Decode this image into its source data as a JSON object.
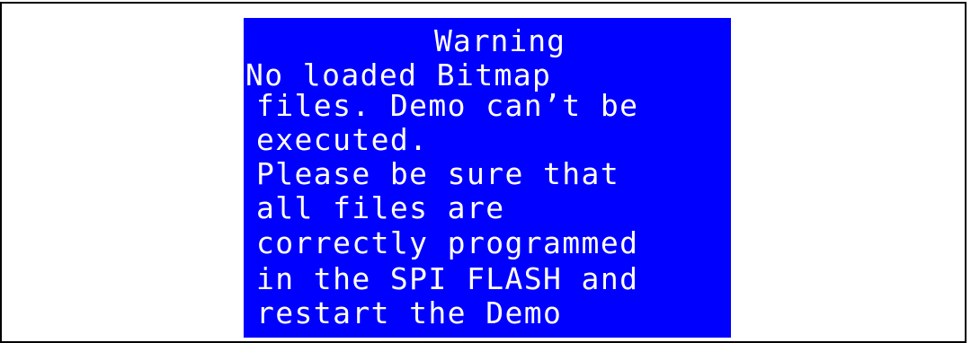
{
  "dialog": {
    "title": "Warning",
    "lines": [
      "No loaded Bitmap",
      "files. Demo can’t be",
      "executed.",
      "Please be sure that",
      "all files are",
      "correctly programmed",
      "in the SPI FLASH and",
      "restart the Demo"
    ]
  },
  "colors": {
    "screen_background": "#0000ff",
    "screen_text": "#ffffff",
    "page_background": "#ffffff",
    "frame_border": "#000000"
  }
}
